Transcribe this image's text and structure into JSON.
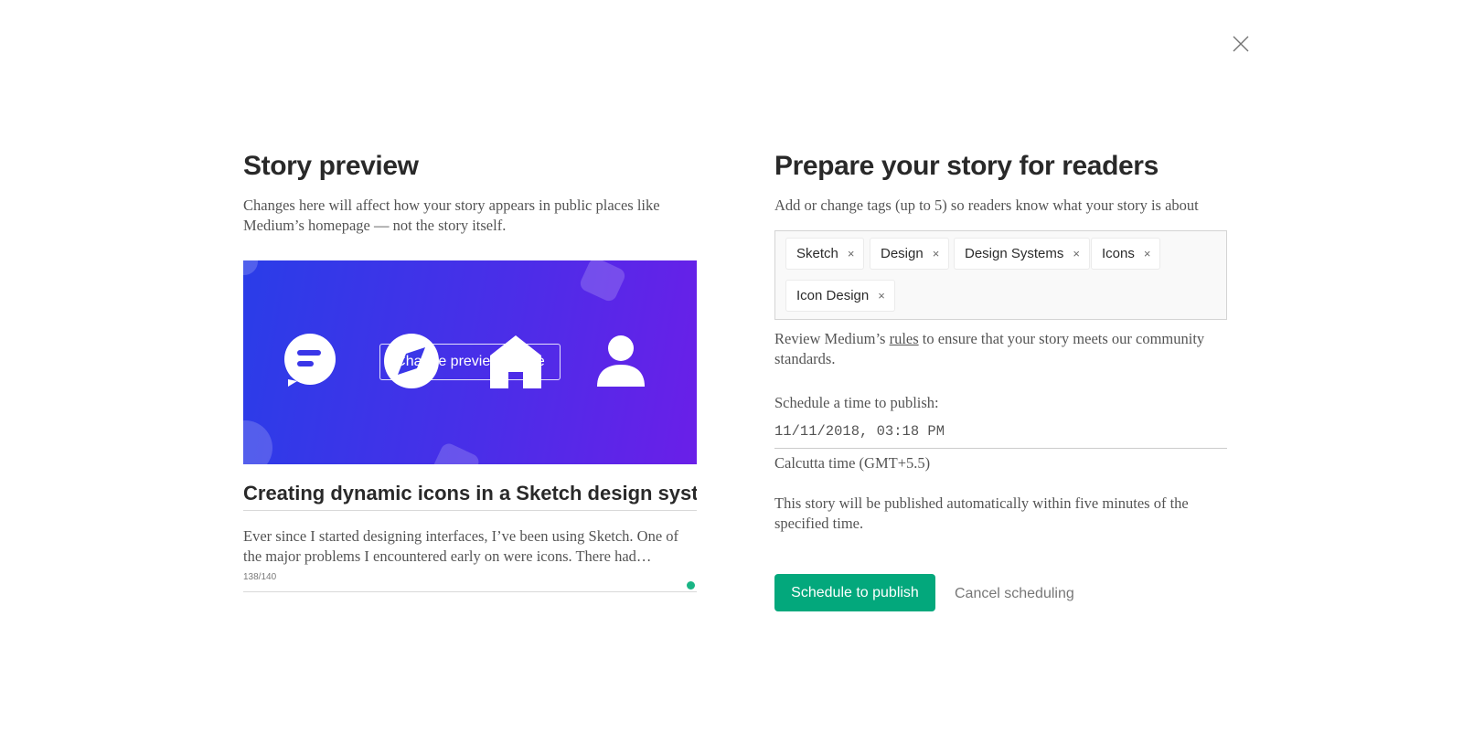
{
  "story_preview": {
    "heading": "Story preview",
    "description": "Changes here will affect how your story appears in public places like Medium’s homepage — not the story itself.",
    "change_image_label": "Change preview image",
    "title": "Creating dynamic icons in a Sketch design system",
    "subtitle": "Ever since I started designing interfaces, I’ve been using Sketch. One of the major problems I encountered early on were icons. There had…",
    "char_count": "138/140",
    "image_icons": [
      "chat-bubble-icon",
      "compass-icon",
      "home-icon",
      "user-icon"
    ]
  },
  "prepare": {
    "heading": "Prepare your story for readers",
    "tags_prompt": "Add or change tags (up to 5) so readers know what your story is about",
    "tags": [
      {
        "label": "Sketch",
        "remove": "×"
      },
      {
        "label": "Design",
        "remove": "×"
      },
      {
        "label": "Design Systems",
        "remove": "×"
      },
      {
        "label": "Icons",
        "remove": "×"
      },
      {
        "label": "Icon Design",
        "remove": "×"
      }
    ],
    "review_before": "Review Medium’s ",
    "review_link": "rules",
    "review_after": " to ensure that your story meets our community standards.",
    "schedule_label": "Schedule a time to publish:",
    "datetime_value": "11/11/2018, 03:18 PM",
    "timezone": "Calcutta time (GMT+5.5)",
    "note": "This story will be published automatically within five minutes of the specified time.",
    "schedule_button": "Schedule to publish",
    "cancel_button": "Cancel scheduling"
  },
  "colors": {
    "accent": "#03a87c",
    "counter_dot": "#1ab585",
    "image_gradient_start": "#2a3de8",
    "image_gradient_end": "#6a1fe8"
  }
}
